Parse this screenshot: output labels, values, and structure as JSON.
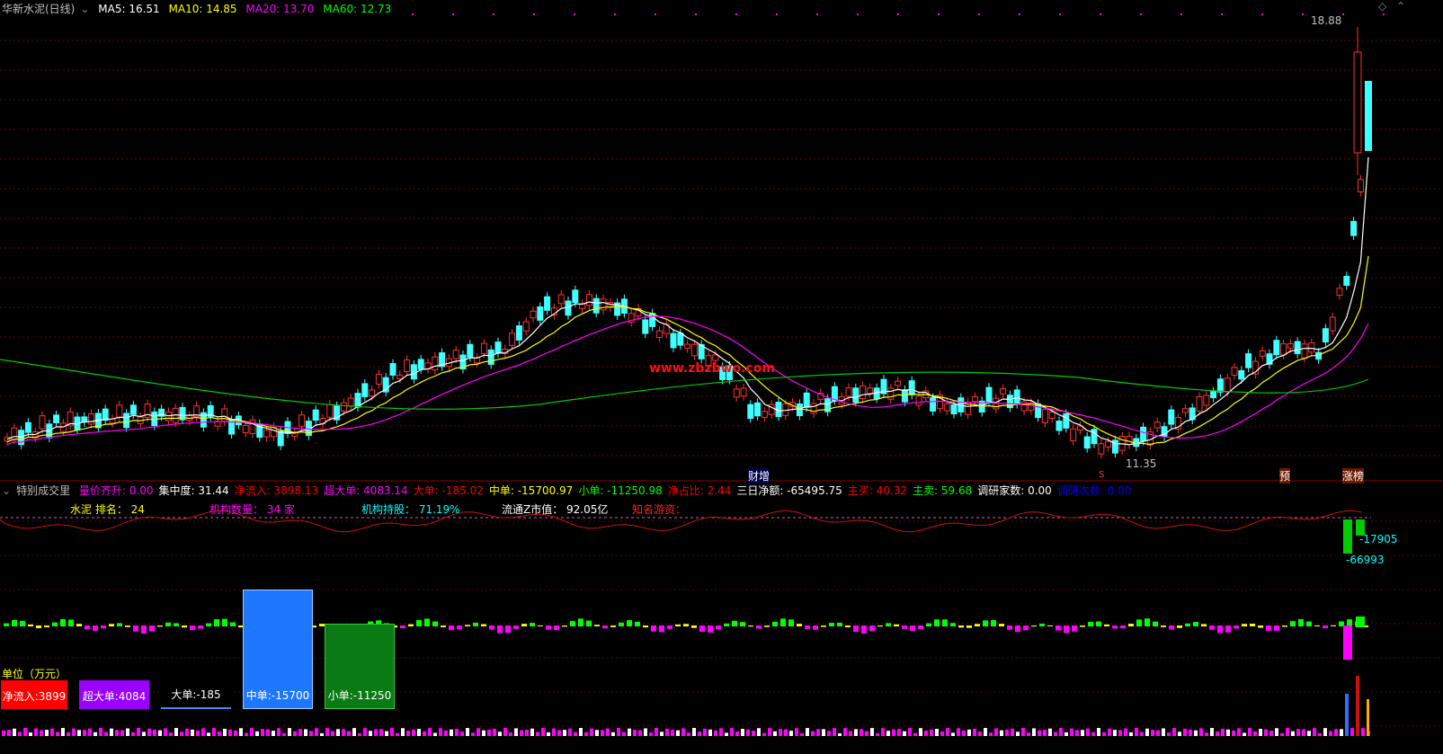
{
  "header": {
    "title": "华新水泥(日线)",
    "ma5_label": "MA5: 16.51",
    "ma10_label": "MA10: 14.85",
    "ma20_label": "MA20: 13.70",
    "ma60_label": "MA60: 12.73",
    "colors": {
      "ma5": "#ffffff",
      "ma10": "#ffff00",
      "ma20": "#ff00ff",
      "ma60": "#00ff00"
    }
  },
  "price_panel": {
    "high_label": "18.88",
    "low_label": "11.35",
    "watermark": "www.zbzbwo.com",
    "event_labels": {
      "caizeng": "财增",
      "s": "S",
      "yu": "预",
      "zhangbang": "涨榜"
    }
  },
  "indicator_bar": {
    "name": "特别成交里",
    "items": [
      {
        "label": "量价齐升: 0.00",
        "color": "#ff00ff"
      },
      {
        "label": "集中度: 31.44",
        "color": "#ffffff"
      },
      {
        "label": "净流入: 3898.13",
        "color": "#ff0000"
      },
      {
        "label": "超大单: 4083.14",
        "color": "#ff00ff"
      },
      {
        "label": "大单: -185.02",
        "color": "#ff0000"
      },
      {
        "label": "中单: -15700.97",
        "color": "#ffff00"
      },
      {
        "label": "小单: -11250.98",
        "color": "#00ff00"
      },
      {
        "label": "净占比: 2.44",
        "color": "#ff0000"
      },
      {
        "label": "三日净额: -65495.75",
        "color": "#ffffff"
      },
      {
        "label": "主买: 40.32",
        "color": "#ff0000"
      },
      {
        "label": "主卖: 59.68",
        "color": "#00ff00"
      },
      {
        "label": "调研家数: 0.00",
        "color": "#ffffff"
      },
      {
        "label": "调研次数: 0.00",
        "color": "#0000ff"
      }
    ]
  },
  "info_row": {
    "rank": "水泥 排名： 24",
    "inst_count": "机构数量： 34  家",
    "inst_hold": "机构持股：  71.19%",
    "float_cap": "流通Z市值：  92.05亿",
    "known_funds": "知名游资："
  },
  "flow_labels": {
    "v1": "-17905",
    "v2": "-66993"
  },
  "unit_label": "单位（万元）",
  "buttons": {
    "net_inflow": "净流入:3899",
    "super_large": "超大单:4084",
    "large": "大单:-185",
    "medium": "中单:-15700",
    "small": "小单:-11250"
  },
  "amounts": {
    "medium": 15700,
    "small": 11250
  }
}
